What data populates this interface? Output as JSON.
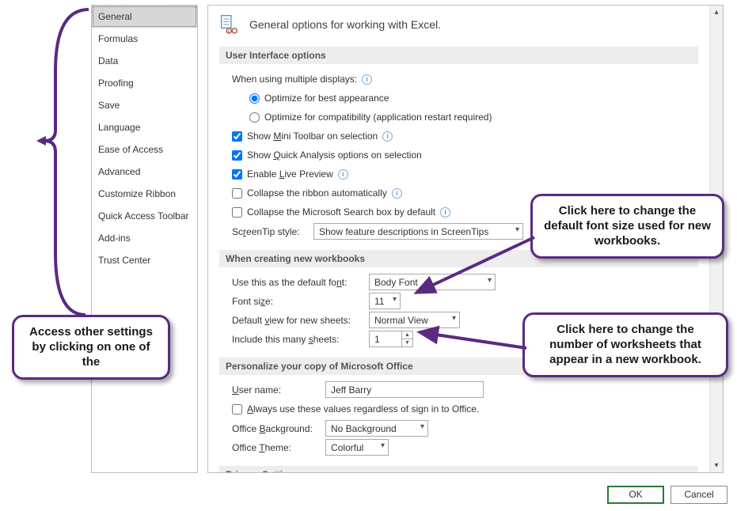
{
  "sidebar": {
    "items": [
      {
        "label": "General",
        "selected": true
      },
      {
        "label": "Formulas"
      },
      {
        "label": "Data"
      },
      {
        "label": "Proofing"
      },
      {
        "label": "Save"
      },
      {
        "label": "Language"
      },
      {
        "label": "Ease of Access"
      },
      {
        "label": "Advanced"
      },
      {
        "label": "Customize Ribbon"
      },
      {
        "label": "Quick Access Toolbar"
      },
      {
        "label": "Add-ins"
      },
      {
        "label": "Trust Center"
      }
    ]
  },
  "header": {
    "title": "General options for working with Excel."
  },
  "sections": {
    "ui": {
      "title": "User Interface options",
      "displays_label": "When using multiple displays:",
      "opt_best": "Optimize for best appearance",
      "opt_compat": "Optimize for compatibility (application restart required)",
      "mini_toolbar": "Show Mini Toolbar on selection",
      "quick_analysis": "Show Quick Analysis options on selection",
      "live_preview": "Enable Live Preview",
      "collapse_ribbon": "Collapse the ribbon automatically",
      "collapse_search": "Collapse the Microsoft Search box by default",
      "screentip_label": "ScreenTip style:",
      "screentip_value": "Show feature descriptions in ScreenTips"
    },
    "newwb": {
      "title": "When creating new workbooks",
      "default_font_label": "Use this as the default font:",
      "default_font_value": "Body Font",
      "font_size_label": "Font size:",
      "font_size_value": "11",
      "default_view_label": "Default view for new sheets:",
      "default_view_value": "Normal View",
      "sheets_label": "Include this many sheets:",
      "sheets_value": "1"
    },
    "personalize": {
      "title": "Personalize your copy of Microsoft Office",
      "user_label": "User name:",
      "user_value": "Jeff Barry",
      "always_values": "Always use these values regardless of sign in to Office.",
      "bg_label": "Office Background:",
      "bg_value": "No Background",
      "theme_label": "Office Theme:",
      "theme_value": "Colorful"
    },
    "privacy": {
      "title": "Privacy Settings"
    }
  },
  "buttons": {
    "ok": "OK",
    "cancel": "Cancel"
  },
  "callouts": {
    "left": "Access other settings by clicking on one of the",
    "font_size": "Click here to change the default font size used for new workbooks.",
    "sheets": "Click here to change the number of worksheets that appear in a new workbook."
  }
}
